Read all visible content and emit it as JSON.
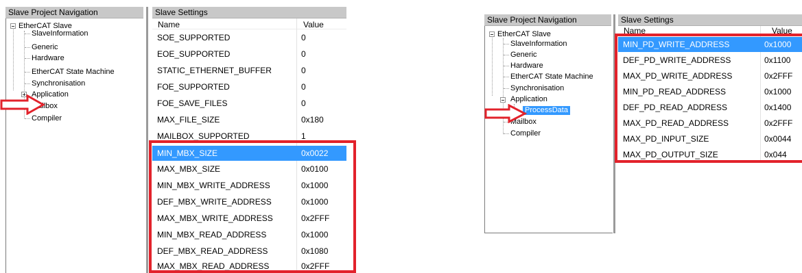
{
  "colors": {
    "selection": "#3399ff",
    "highlight_frame": "#e2222b",
    "pane_header": "#c8c8c8"
  },
  "left": {
    "nav_title": "Slave Project Navigation",
    "settings_title": "Slave Settings",
    "tree": {
      "root": "EtherCAT Slave",
      "items": [
        "SlaveInformation",
        "Generic",
        "Hardware",
        "EtherCAT State Machine",
        "Synchronisation",
        "Application",
        "Mailbox",
        "Compiler"
      ]
    },
    "columns": {
      "name": "Name",
      "value": "Value"
    },
    "rows": [
      {
        "name": "SOE_SUPPORTED",
        "value": "0"
      },
      {
        "name": "EOE_SUPPORTED",
        "value": "0"
      },
      {
        "name": "STATIC_ETHERNET_BUFFER",
        "value": "0"
      },
      {
        "name": "FOE_SUPPORTED",
        "value": "0"
      },
      {
        "name": "FOE_SAVE_FILES",
        "value": "0"
      },
      {
        "name": "MAX_FILE_SIZE",
        "value": "0x180"
      },
      {
        "name": "MAILBOX_SUPPORTED",
        "value": "1"
      },
      {
        "name": "MIN_MBX_SIZE",
        "value": "0x0022"
      },
      {
        "name": "MAX_MBX_SIZE",
        "value": "0x0100"
      },
      {
        "name": "MIN_MBX_WRITE_ADDRESS",
        "value": "0x1000"
      },
      {
        "name": "DEF_MBX_WRITE_ADDRESS",
        "value": "0x1000"
      },
      {
        "name": "MAX_MBX_WRITE_ADDRESS",
        "value": "0x2FFF"
      },
      {
        "name": "MIN_MBX_READ_ADDRESS",
        "value": "0x1000"
      },
      {
        "name": "DEF_MBX_READ_ADDRESS",
        "value": "0x1080"
      },
      {
        "name": "MAX_MBX_READ_ADDRESS",
        "value": "0x2FFF"
      }
    ]
  },
  "right": {
    "nav_title": "Slave Project Navigation",
    "settings_title": "Slave Settings",
    "tree": {
      "root": "EtherCAT Slave",
      "items": [
        "SlaveInformation",
        "Generic",
        "Hardware",
        "EtherCAT State Machine",
        "Synchronisation",
        "Application",
        "ProcessData",
        "Mailbox",
        "Compiler"
      ]
    },
    "columns": {
      "name": "Name",
      "value": "Value"
    },
    "rows": [
      {
        "name": "MIN_PD_WRITE_ADDRESS",
        "value": "0x1000"
      },
      {
        "name": "DEF_PD_WRITE_ADDRESS",
        "value": "0x1100"
      },
      {
        "name": "MAX_PD_WRITE_ADDRESS",
        "value": "0x2FFF"
      },
      {
        "name": "MIN_PD_READ_ADDRESS",
        "value": "0x1000"
      },
      {
        "name": "DEF_PD_READ_ADDRESS",
        "value": "0x1400"
      },
      {
        "name": "MAX_PD_READ_ADDRESS",
        "value": "0x2FFF"
      },
      {
        "name": "MAX_PD_INPUT_SIZE",
        "value": "0x0044"
      },
      {
        "name": "MAX_PD_OUTPUT_SIZE",
        "value": "0x044"
      }
    ]
  }
}
